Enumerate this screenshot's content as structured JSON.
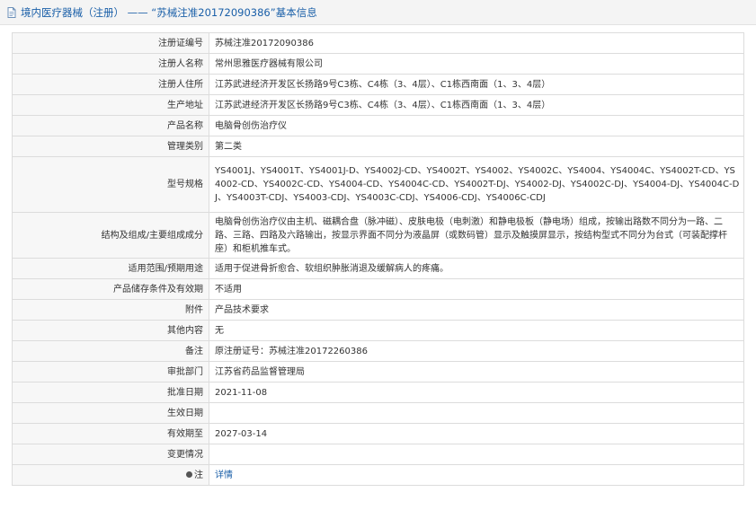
{
  "header": {
    "title": "境内医疗器械（注册） —— “苏械注准20172090386”基本信息"
  },
  "rows": [
    {
      "label": "注册证编号",
      "value": "苏械注准20172090386"
    },
    {
      "label": "注册人名称",
      "value": "常州思雅医疗器械有限公司"
    },
    {
      "label": "注册人住所",
      "value": "江苏武进经济开发区长扬路9号C3栋、C4栋（3、4层）、C1栋西南面（1、3、4层）"
    },
    {
      "label": "生产地址",
      "value": "江苏武进经济开发区长扬路9号C3栋、C4栋（3、4层）、C1栋西南面（1、3、4层）"
    },
    {
      "label": "产品名称",
      "value": "电脑骨创伤治疗仪"
    },
    {
      "label": "管理类别",
      "value": "第二类"
    },
    {
      "label": "型号规格",
      "value": "YS4001J、YS4001T、YS4001J-D、YS4002J-CD、YS4002T、YS4002、YS4002C、YS4004、YS4004C、YS4002T-CD、YS4002-CD、YS4002C-CD、YS4004-CD、YS4004C-CD、YS4002T-DJ、YS4002-DJ、YS4002C-DJ、YS4004-DJ、YS4004C-DJ、YS4003T-CDJ、YS4003-CDJ、YS4003C-CDJ、YS4006-CDJ、YS4006C-CDJ"
    },
    {
      "label": "结构及组成/主要组成成分",
      "value": "电脑骨创伤治疗仪由主机、磁耦合盘（脉冲磁）、皮肤电极（电刺激）和静电极板（静电场）组成，按输出路数不同分为一路、二路、三路、四路及六路输出，按显示界面不同分为液晶屏（或数码管）显示及触摸屏显示，按结构型式不同分为台式（可装配撑杆座）和柜机推车式。"
    },
    {
      "label": "适用范围/预期用途",
      "value": "适用于促进骨折愈合、软组织肿胀消退及缓解病人的疼痛。"
    },
    {
      "label": "产品储存条件及有效期",
      "value": "不适用"
    },
    {
      "label": "附件",
      "value": "产品技术要求"
    },
    {
      "label": "其他内容",
      "value": "无"
    },
    {
      "label": "备注",
      "value": "原注册证号：苏械注准20172260386"
    },
    {
      "label": "审批部门",
      "value": "江苏省药品监督管理局"
    },
    {
      "label": "批准日期",
      "value": "2021-11-08"
    },
    {
      "label": "生效日期",
      "value": ""
    },
    {
      "label": "有效期至",
      "value": "2027-03-14"
    },
    {
      "label": "变更情况",
      "value": ""
    },
    {
      "label": "注",
      "value": "详情"
    }
  ],
  "icons": {
    "header": "document-icon",
    "note": "note-dot-icon"
  },
  "colors": {
    "link": "#1a5fa8",
    "label_bg": "#f7f7f7",
    "border": "#dcdcdc",
    "header_bg": "#f4f4f4"
  }
}
